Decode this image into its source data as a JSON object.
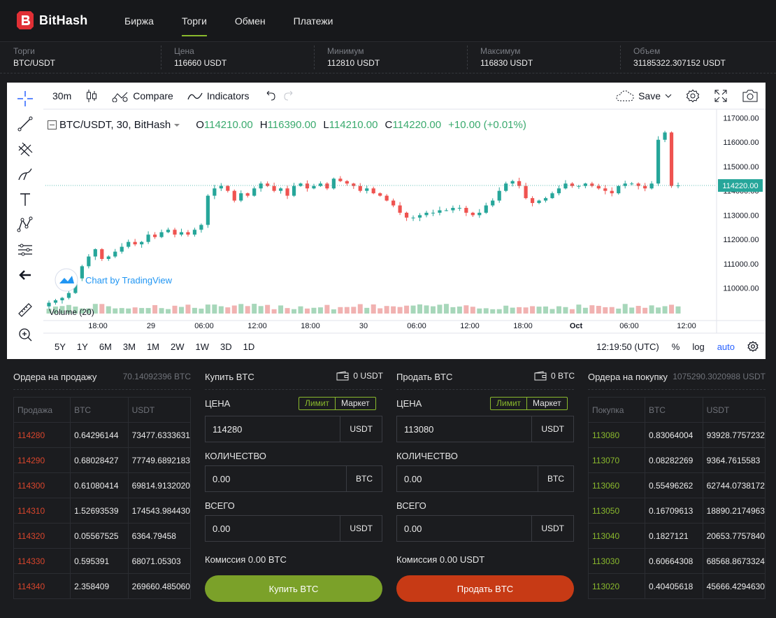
{
  "brand": {
    "name": "BitHash",
    "color": "#e02f35"
  },
  "nav": [
    {
      "label": "Биржа"
    },
    {
      "label": "Торги"
    },
    {
      "label": "Обмен"
    },
    {
      "label": "Платежи"
    }
  ],
  "stats": [
    {
      "label": "Торги",
      "value": "BTC/USDT"
    },
    {
      "label": "Цена",
      "value": "116660 USDT"
    },
    {
      "label": "Минимум",
      "value": "112810 USDT"
    },
    {
      "label": "Максимум",
      "value": "116830 USDT"
    },
    {
      "label": "Объем",
      "value": "31185322.307152 USDT"
    }
  ],
  "chart": {
    "interval": "30m",
    "compare": "Compare",
    "indicators": "Indicators",
    "save": "Save",
    "symbol": "BTC/USDT, 30, BitHash",
    "ohlc": {
      "o_label": "O",
      "o": "114210.00",
      "h_label": "H",
      "h": "116390.00",
      "l_label": "L",
      "l": "114210.00",
      "c_label": "C",
      "c": "114220.00",
      "change": "+10.00 (+0.01%)"
    },
    "watermark": "Chart by TradingView",
    "volume_label": "Volume (20)",
    "current_price": "114220.00",
    "timeframes": [
      "5Y",
      "1Y",
      "6M",
      "3M",
      "1M",
      "2W",
      "1W",
      "3D",
      "1D"
    ],
    "clock": "12:19:50 (UTC)",
    "percent": "%",
    "log": "log",
    "auto": "auto",
    "up_color": "#26a69a",
    "down_color": "#ef5350"
  },
  "chart_data": {
    "type": "candlestick",
    "title": "BTC/USDT, 30, BitHash",
    "y_ticks": [
      "117000.00",
      "116000.00",
      "115000.00",
      "114000.00",
      "113000.00",
      "112000.00",
      "111000.00",
      "110000.00"
    ],
    "ylim": [
      109300,
      117300
    ],
    "x_ticks": [
      "18:00",
      "29",
      "06:00",
      "12:00",
      "18:00",
      "30",
      "06:00",
      "12:00",
      "18:00",
      "Oct",
      "06:00",
      "12:00"
    ],
    "close_path": [
      109400,
      109500,
      109600,
      109800,
      110400,
      110900,
      111300,
      111600,
      111200,
      111300,
      111500,
      111700,
      111900,
      111800,
      111900,
      112200,
      112100,
      112300,
      112400,
      112200,
      112300,
      112200,
      112400,
      112600,
      113800,
      114100,
      114200,
      114000,
      113600,
      113900,
      113800,
      114100,
      114300,
      114200,
      114000,
      114100,
      113800,
      114200,
      114300,
      114100,
      114200,
      114300,
      114100,
      114500,
      114400,
      114300,
      114200,
      114000,
      114100,
      113900,
      113800,
      113600,
      113400,
      113100,
      112900,
      112900,
      113000,
      113100,
      113100,
      113200,
      113200,
      113300,
      113300,
      113100,
      113000,
      113100,
      113400,
      113600,
      114000,
      114300,
      114400,
      114200,
      113700,
      113500,
      113600,
      113700,
      113900,
      114100,
      114300,
      114200,
      114200,
      114300,
      114200,
      114100,
      114000,
      113900,
      114200,
      114300,
      114300,
      114200,
      114100,
      114300,
      116100,
      116400,
      114200,
      114220
    ]
  },
  "orderbook_sell": {
    "title": "Ордера на продажу",
    "total": "70.14092396 BTC",
    "headers": [
      "Продажа",
      "BTC",
      "USDT"
    ],
    "rows": [
      [
        "114280",
        "0.64296144",
        "73477.6333631"
      ],
      [
        "114290",
        "0.68028427",
        "77749.6892183"
      ],
      [
        "114300",
        "0.61080414",
        "69814.9132020"
      ],
      [
        "114310",
        "1.52693539",
        "174543.984430"
      ],
      [
        "114320",
        "0.05567525",
        "6364.79458"
      ],
      [
        "114330",
        "0.595391",
        "68071.05303"
      ],
      [
        "114340",
        "2.358409",
        "269660.485060"
      ]
    ]
  },
  "buy_form": {
    "title": "Купить BTC",
    "balance": "0 USDT",
    "price_label": "ЦЕНА",
    "limit": "Лимит",
    "market": "Маркет",
    "price": "114280",
    "price_unit": "USDT",
    "qty_label": "КОЛИЧЕСТВО",
    "qty": "0.00",
    "qty_unit": "BTC",
    "total_label": "ВСЕГО",
    "total": "0.00",
    "total_unit": "USDT",
    "fee": "Комиссия 0.00 BTC",
    "button": "Купить BTC",
    "accent": "#7ba129"
  },
  "sell_form": {
    "title": "Продать BTC",
    "balance": "0 BTC",
    "price_label": "ЦЕНА",
    "limit": "Лимит",
    "market": "Маркет",
    "price": "113080",
    "price_unit": "USDT",
    "qty_label": "КОЛИЧЕСТВО",
    "qty": "0.00",
    "qty_unit": "BTC",
    "total_label": "ВСЕГО",
    "total": "0.00",
    "total_unit": "USDT",
    "fee": "Комиссия 0.00 USDT",
    "button": "Продать BTC",
    "accent": "#c73a15"
  },
  "orderbook_buy": {
    "title": "Ордера на покупку",
    "total": "1075290.3020988 USDT",
    "headers": [
      "Покупка",
      "BTC",
      "USDT"
    ],
    "rows": [
      [
        "113080",
        "0.83064004",
        "93928.7757232"
      ],
      [
        "113070",
        "0.08282269",
        "9364.7615583"
      ],
      [
        "113060",
        "0.55496262",
        "62744.0738172"
      ],
      [
        "113050",
        "0.16709613",
        "18890.2174963"
      ],
      [
        "113040",
        "0.1827121",
        "20653.7757840"
      ],
      [
        "113030",
        "0.60664308",
        "68568.8673324"
      ],
      [
        "113020",
        "0.40405618",
        "45666.4294630"
      ]
    ]
  }
}
